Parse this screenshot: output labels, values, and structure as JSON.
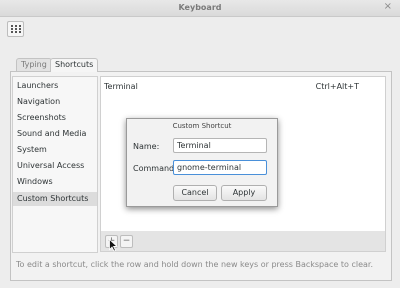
{
  "window": {
    "title": "Keyboard",
    "close_icon": "×"
  },
  "tabs": [
    {
      "label": "Typing"
    },
    {
      "label": "Shortcuts"
    }
  ],
  "sidebar": {
    "items": [
      {
        "label": "Launchers"
      },
      {
        "label": "Navigation"
      },
      {
        "label": "Screenshots"
      },
      {
        "label": "Sound and Media"
      },
      {
        "label": "System"
      },
      {
        "label": "Universal Access"
      },
      {
        "label": "Windows"
      },
      {
        "label": "Custom Shortcuts"
      }
    ],
    "selected": "Custom Shortcuts"
  },
  "shortcuts": [
    {
      "name": "Terminal",
      "accel": "Ctrl+Alt+T"
    }
  ],
  "toolbar": {
    "add_icon": "+",
    "remove_icon": "−"
  },
  "hint": "To edit a shortcut, click the row and hold down the new keys or press Backspace to clear.",
  "dialog": {
    "title": "Custom Shortcut",
    "name_label": "Name:",
    "name_value": "Terminal",
    "command_label": "Command:",
    "command_value": "gnome-terminal",
    "cancel_label": "Cancel",
    "apply_label": "Apply"
  }
}
